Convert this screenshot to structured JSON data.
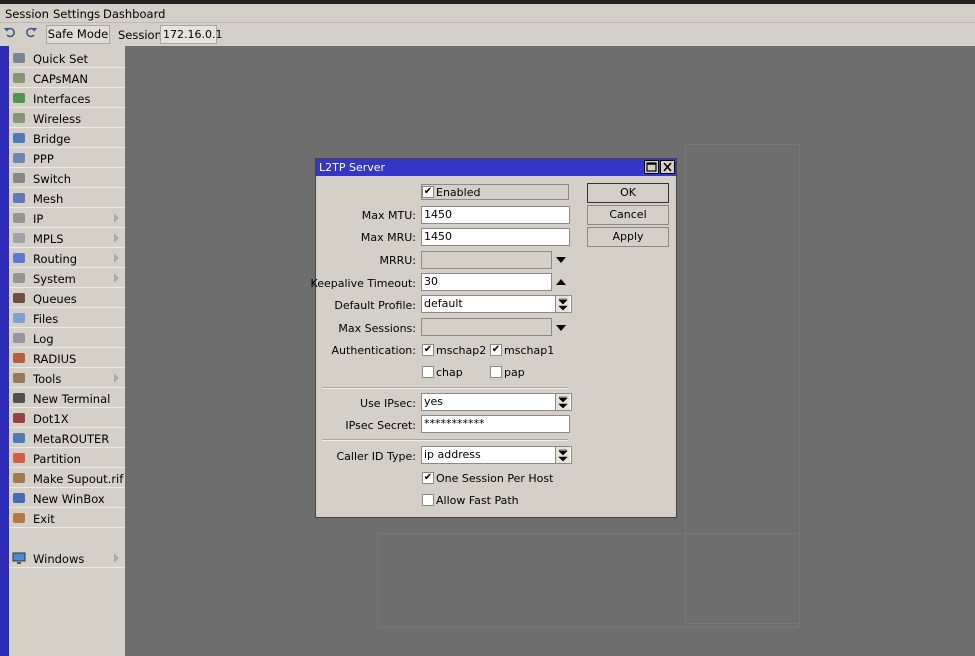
{
  "menu": {
    "session": "Session",
    "settings": "Settings",
    "dashboard": "Dashboard"
  },
  "toolbar": {
    "undo_icon": "undo-icon",
    "redo_icon": "redo-icon",
    "safe_mode": "Safe Mode",
    "session_label": "Session:",
    "session_value": "172.16.0.1"
  },
  "sidebar": {
    "items": [
      {
        "label": "Quick Set",
        "icon": "wand-icon"
      },
      {
        "label": "CAPsMAN",
        "icon": "antenna-icon"
      },
      {
        "label": "Interfaces",
        "icon": "network-card-icon"
      },
      {
        "label": "Wireless",
        "icon": "antenna-icon"
      },
      {
        "label": "Bridge",
        "icon": "bridge-icon"
      },
      {
        "label": "PPP",
        "icon": "ppp-icon"
      },
      {
        "label": "Switch",
        "icon": "switch-icon"
      },
      {
        "label": "Mesh",
        "icon": "mesh-icon"
      },
      {
        "label": "IP",
        "icon": "ip-icon"
      },
      {
        "label": "MPLS",
        "icon": "mpls-icon"
      },
      {
        "label": "Routing",
        "icon": "routing-icon"
      },
      {
        "label": "System",
        "icon": "gear-icon"
      },
      {
        "label": "Queues",
        "icon": "queue-icon"
      },
      {
        "label": "Files",
        "icon": "folder-icon"
      },
      {
        "label": "Log",
        "icon": "log-icon"
      },
      {
        "label": "RADIUS",
        "icon": "users-icon"
      },
      {
        "label": "Tools",
        "icon": "tools-icon"
      },
      {
        "label": "New Terminal",
        "icon": "terminal-icon"
      },
      {
        "label": "Dot1X",
        "icon": "dot1x-icon"
      },
      {
        "label": "MetaROUTER",
        "icon": "metarouter-icon"
      },
      {
        "label": "Partition",
        "icon": "pie-icon"
      },
      {
        "label": "Make Supout.rif",
        "icon": "supout-icon"
      },
      {
        "label": "New WinBox",
        "icon": "globe-icon"
      },
      {
        "label": "Exit",
        "icon": "exit-door-icon"
      }
    ],
    "windows": "Windows"
  },
  "dialog": {
    "title": "L2TP Server",
    "enabled_label": "Enabled",
    "max_mtu_label": "Max MTU:",
    "max_mtu": "1450",
    "max_mru_label": "Max MRU:",
    "max_mru": "1450",
    "mrru_label": "MRRU:",
    "mrru": "",
    "keepalive_label": "Keepalive Timeout:",
    "keepalive": "30",
    "default_profile_label": "Default Profile:",
    "default_profile": "default",
    "max_sessions_label": "Max Sessions:",
    "max_sessions": "",
    "authentication_label": "Authentication:",
    "auth_mschap2": "mschap2",
    "auth_mschap1": "mschap1",
    "auth_chap": "chap",
    "auth_pap": "pap",
    "use_ipsec_label": "Use IPsec:",
    "use_ipsec": "yes",
    "ipsec_secret_label": "IPsec Secret:",
    "ipsec_secret": "***********",
    "caller_id_label": "Caller ID Type:",
    "caller_id": "ip address",
    "one_session_label": "One Session Per Host",
    "allow_fast_path_label": "Allow Fast Path",
    "ok": "OK",
    "cancel": "Cancel",
    "apply": "Apply",
    "check_mark": "✔"
  }
}
